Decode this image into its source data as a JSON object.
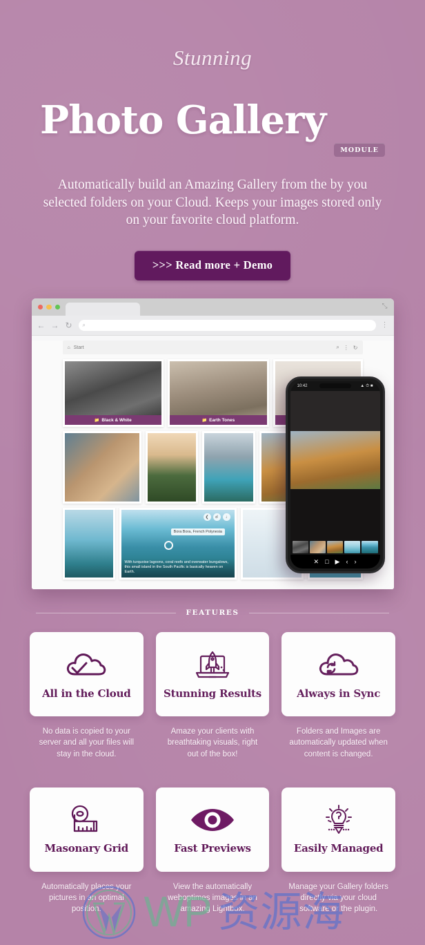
{
  "theme": {
    "background": "#b583a8",
    "accent_dark": "#611a5e",
    "accent_mid": "#7b3a72",
    "badge_bg": "#9c6d93",
    "card_bg": "#fdfdfd",
    "text_light": "#fdf6fb"
  },
  "hero": {
    "script_line": "Stunning",
    "title": "Photo Gallery",
    "badge": "MODULE",
    "description": "Automatically build an Amazing Gallery from the by you selected folders on your Cloud. Keeps your images stored only on your favorite cloud platform.",
    "cta_label": ">>> Read more + Demo"
  },
  "browser": {
    "traffic_lights": [
      "close-red",
      "minimize-yellow",
      "maximize-green"
    ],
    "back_icon": "←",
    "forward_icon": "→",
    "reload_icon": "↻",
    "url_placeholder": "",
    "url_value": "",
    "search_icon": "⌕",
    "menu_icon": "⋮",
    "expand_icon": "⤡"
  },
  "gallery_app": {
    "breadcrumb": "Start",
    "home_icon": "⌂",
    "toolbar_icons": [
      "search-icon",
      "menu-icon",
      "refresh-icon"
    ],
    "folders": [
      {
        "label": "Black & White"
      },
      {
        "label": "Earth Tones"
      }
    ],
    "lightbox": {
      "hotspot_tooltip": "Bora Bora, French Polynesia",
      "caption": "With turquoise lagoons, coral reefs and overwater bungalows, this small island in the South Pacific is basically heaven on Earth.",
      "actions": [
        "share-icon",
        "link-icon",
        "download-icon"
      ]
    }
  },
  "phone": {
    "time": "10:42",
    "status_icons": [
      "signal-icon",
      "wifi-icon",
      "battery-icon"
    ],
    "controls": [
      "close-icon",
      "fullscreen-icon",
      "play-icon",
      "prev-icon",
      "next-icon"
    ],
    "control_glyphs": [
      "✕",
      "□",
      "▶",
      "‹",
      "›"
    ]
  },
  "features_section": {
    "divider_label": "FEATURES",
    "items": [
      {
        "icon": "cloud-check-icon",
        "title": "All in the Cloud",
        "description": "No data is copied to your server and all your files will stay in the cloud."
      },
      {
        "icon": "laptop-rocket-icon",
        "title": "Stunning Results",
        "description": "Amaze your clients with breathtaking visuals, right out of the box!"
      },
      {
        "icon": "cloud-sync-icon",
        "title": "Always in Sync",
        "description": "Folders and Images are automatically updated when content is changed."
      },
      {
        "icon": "measuring-tape-icon",
        "title": "Masonary Grid",
        "description": "Automatically places your pictures in an optimal position."
      },
      {
        "icon": "eye-icon",
        "title": "Fast Previews",
        "description": "View the automatically weboptimes images in an amazing Lightbox."
      },
      {
        "icon": "lightbulb-pencil-icon",
        "title": "Easily Managed",
        "description": "Manage your Gallery folders directly via your cloud software or the plugin."
      }
    ]
  },
  "watermark": {
    "logo": "wordpress-logo-icon",
    "latin_text": "WP",
    "cjk_text": "资源海",
    "colors": {
      "latin": "#63b98e",
      "cjk": "#4f6fd0"
    }
  }
}
